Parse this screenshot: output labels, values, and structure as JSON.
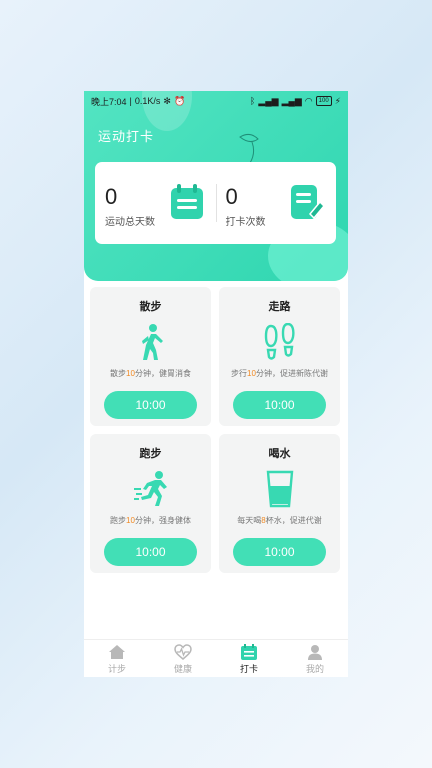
{
  "status_bar": {
    "time": "晚上7:04",
    "speed": "0.1K/s",
    "battery": "100"
  },
  "header": {
    "title": "运动打卡"
  },
  "stats": [
    {
      "value": "0",
      "label": "运动总天数",
      "icon": "calendar-icon"
    },
    {
      "value": "0",
      "label": "打卡次数",
      "icon": "note-edit-icon"
    }
  ],
  "cards": [
    {
      "title": "散步",
      "icon": "walking-person-icon",
      "desc_pre": "散步",
      "desc_hl": "10",
      "desc_post": "分钟，健胃消食",
      "time": "10:00"
    },
    {
      "title": "走路",
      "icon": "footprints-icon",
      "desc_pre": "步行",
      "desc_hl": "10",
      "desc_post": "分钟，促进新陈代谢",
      "time": "10:00"
    },
    {
      "title": "跑步",
      "icon": "running-person-icon",
      "desc_pre": "跑步",
      "desc_hl": "10",
      "desc_post": "分钟，强身健体",
      "time": "10:00"
    },
    {
      "title": "喝水",
      "icon": "water-glass-icon",
      "desc_pre": "每天喝",
      "desc_hl": "8",
      "desc_post": "杯水，促进代谢",
      "time": "10:00"
    }
  ],
  "tabs": [
    {
      "label": "计步",
      "icon": "home-icon",
      "active": false
    },
    {
      "label": "健康",
      "icon": "heart-pulse-icon",
      "active": false
    },
    {
      "label": "打卡",
      "icon": "calendar-check-icon",
      "active": true
    },
    {
      "label": "我的",
      "icon": "person-icon",
      "active": false
    }
  ],
  "colors": {
    "accent": "#42dfb6",
    "highlight": "#f08a24"
  }
}
